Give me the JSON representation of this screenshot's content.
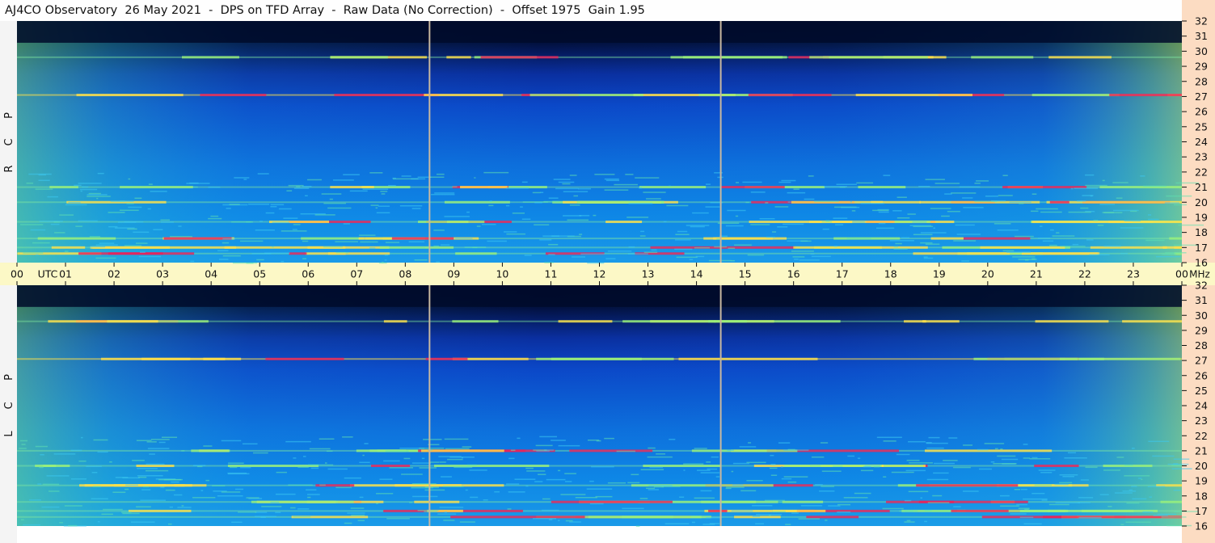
{
  "title": "AJ4CO Observatory  26 May 2021  -  DPS on TFD Array  -  Raw Data (No Correction)  -  Offset 1975  Gain 1.95",
  "colors": {
    "background_low": "#000a2a",
    "mid": "#0a8ee8",
    "high": "#ffe04a",
    "peak": "#e8205a",
    "time_band": "#fcf8c6",
    "right_strip": "#fcdcc2",
    "cursor_line": "#c8b8a0"
  },
  "chart_data": [
    {
      "type": "heatmap",
      "name": "RCP",
      "polarization_letters": [
        "R",
        "C",
        "P"
      ],
      "x_unit": "UTC",
      "y_unit": "MHz",
      "xlim": [
        0,
        24
      ],
      "ylim": [
        16,
        32
      ],
      "x_ticks": [
        "00",
        "01",
        "02",
        "03",
        "04",
        "05",
        "06",
        "07",
        "08",
        "09",
        "10",
        "11",
        "12",
        "13",
        "14",
        "15",
        "16",
        "17",
        "18",
        "19",
        "20",
        "21",
        "22",
        "23",
        "00"
      ],
      "y_ticks": [
        "16",
        "17",
        "18",
        "19",
        "20",
        "21",
        "22",
        "23",
        "24",
        "25",
        "26",
        "27",
        "28",
        "29",
        "30",
        "31",
        "32"
      ],
      "cursor_lines_utc": [
        8.5,
        14.5
      ],
      "interference_bands_mhz": [
        16.6,
        17.0,
        17.6,
        18.7,
        20.0,
        21.0,
        27.1,
        29.6
      ]
    },
    {
      "type": "heatmap",
      "name": "LCP",
      "polarization_letters": [
        "L",
        "C",
        "P"
      ],
      "x_unit": "UTC",
      "y_unit": "MHz",
      "xlim": [
        0,
        24
      ],
      "ylim": [
        16,
        32
      ],
      "x_ticks": [
        "00",
        "01",
        "02",
        "03",
        "04",
        "05",
        "06",
        "07",
        "08",
        "09",
        "10",
        "11",
        "12",
        "13",
        "14",
        "15",
        "16",
        "17",
        "18",
        "19",
        "20",
        "21",
        "22",
        "23",
        "00"
      ],
      "y_ticks": [
        "16",
        "17",
        "18",
        "19",
        "20",
        "21",
        "22",
        "23",
        "24",
        "25",
        "26",
        "27",
        "28",
        "29",
        "30",
        "31",
        "32"
      ],
      "cursor_lines_utc": [
        8.5,
        14.5
      ],
      "interference_bands_mhz": [
        16.6,
        17.0,
        17.6,
        18.7,
        20.0,
        21.0,
        27.1,
        29.6
      ]
    }
  ],
  "axis": {
    "utc_label": "UTC",
    "mhz_label": "MHz"
  }
}
